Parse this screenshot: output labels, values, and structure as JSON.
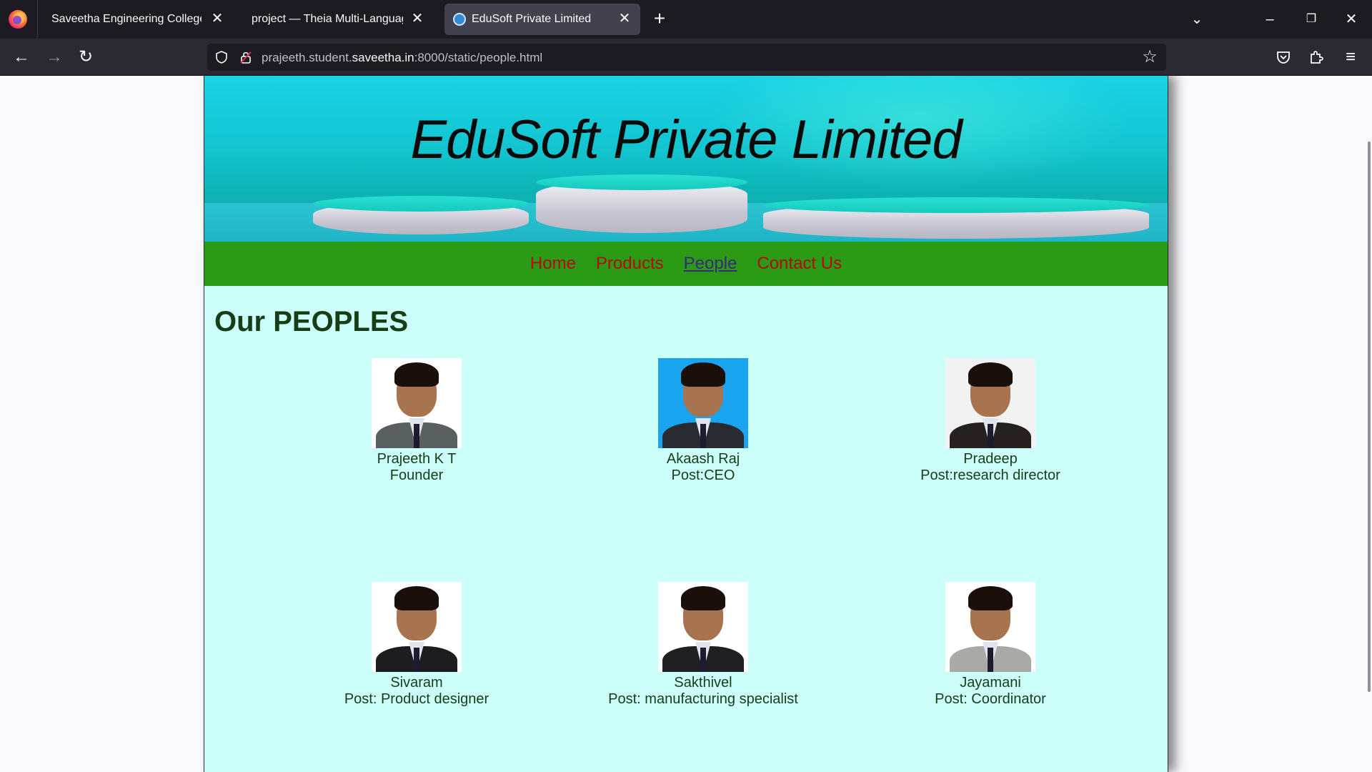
{
  "browser": {
    "tabs": [
      {
        "title": "Saveetha Engineering College",
        "active": false
      },
      {
        "title": "project — Theia Multi-Language Ex",
        "active": false
      },
      {
        "title": "EduSoft Private Limited",
        "active": true
      }
    ],
    "url_prefix": "prajeeth.student.",
    "url_domain": "saveetha.in",
    "url_suffix": ":8000/static/people.html"
  },
  "site": {
    "title": "EduSoft Private Limited",
    "nav": [
      "Home",
      "Products",
      "People",
      "Contact Us"
    ],
    "current_nav": "People"
  },
  "people_section": {
    "heading": "Our PEOPLES",
    "people": [
      {
        "name": "Prajeeth K T",
        "post": "Founder",
        "photo_bg": "#ffffff",
        "suit": "#5a5f62"
      },
      {
        "name": "Akaash Raj",
        "post": "Post:CEO",
        "photo_bg": "#1aa3ee",
        "suit": "#2a2b30"
      },
      {
        "name": "Pradeep",
        "post": "Post:research director",
        "photo_bg": "#f2f2f2",
        "suit": "#26211f"
      },
      {
        "name": "Sivaram",
        "post": "Post: Product designer",
        "photo_bg": "#ffffff",
        "suit": "#1d1d1f"
      },
      {
        "name": "Sakthivel",
        "post": "Post: manufacturing specialist",
        "photo_bg": "#ffffff",
        "suit": "#202022"
      },
      {
        "name": "Jayamani",
        "post": "Post: Coordinator",
        "photo_bg": "#ffffff",
        "suit": "#a9a9a6"
      }
    ]
  },
  "colors": {
    "menu_bg": "#2b9a15",
    "menu_link": "#b30a0a",
    "page_bg": "#ccfffa",
    "heading": "#173d17"
  }
}
